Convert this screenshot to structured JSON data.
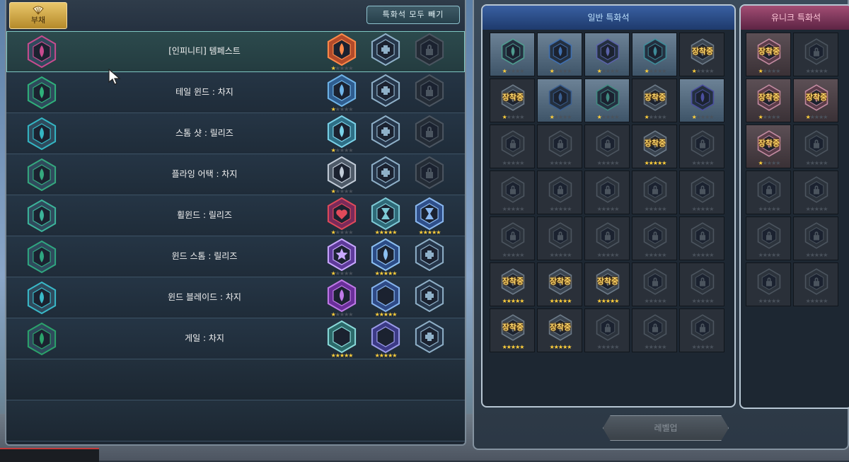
{
  "skill_panel": {
    "tab_label": "부채",
    "remove_all_label": "특화석 모두 빼기",
    "skills": [
      {
        "name": "[인피니티] 템페스트",
        "icon": "tempest-skill-icon",
        "icon_color": "#c84b8f",
        "slots": [
          {
            "state": "gem",
            "gem": "red-flame",
            "stars": 1
          },
          {
            "state": "add"
          },
          {
            "state": "locked"
          }
        ]
      },
      {
        "name": "테일 윈드 : 차지",
        "icon": "tailwind-skill-icon",
        "icon_color": "#2fb07a",
        "slots": [
          {
            "state": "gem",
            "gem": "blue-flame",
            "stars": 1
          },
          {
            "state": "add"
          },
          {
            "state": "locked"
          }
        ]
      },
      {
        "name": "스톰 샷 : 릴리즈",
        "icon": "storm-shot-skill-icon",
        "icon_color": "#34b6c4",
        "slots": [
          {
            "state": "gem",
            "gem": "cyan-flame",
            "stars": 1
          },
          {
            "state": "add"
          },
          {
            "state": "locked"
          }
        ]
      },
      {
        "name": "플라잉 어택 : 차지",
        "icon": "flying-attack-skill-icon",
        "icon_color": "#35a87e",
        "slots": [
          {
            "state": "gem",
            "gem": "silver-flame",
            "stars": 1
          },
          {
            "state": "add"
          },
          {
            "state": "locked"
          }
        ]
      },
      {
        "name": "휠윈드 : 릴리즈",
        "icon": "whirlwind-skill-icon",
        "icon_color": "#3cb49a",
        "slots": [
          {
            "state": "gem",
            "gem": "red-heart",
            "stars": 1
          },
          {
            "state": "gem",
            "gem": "hourglass-teal",
            "stars": 5
          },
          {
            "state": "gem",
            "gem": "hourglass-blue",
            "stars": 5
          }
        ]
      },
      {
        "name": "윈드 스톰 : 릴리즈",
        "icon": "windstorm-skill-icon",
        "icon_color": "#2fa680",
        "slots": [
          {
            "state": "gem",
            "gem": "purple-star",
            "stars": 1
          },
          {
            "state": "gem",
            "gem": "wing-blue",
            "stars": 5
          },
          {
            "state": "add"
          }
        ]
      },
      {
        "name": "윈드 블레이드 : 차지",
        "icon": "wind-blade-skill-icon",
        "icon_color": "#39b9c9",
        "slots": [
          {
            "state": "gem",
            "gem": "purple-drop",
            "stars": 1
          },
          {
            "state": "gem",
            "gem": "moon-blue",
            "stars": 5
          },
          {
            "state": "add"
          }
        ]
      },
      {
        "name": "게일 : 차지",
        "icon": "gale-skill-icon",
        "icon_color": "#2ba36b",
        "slots": [
          {
            "state": "gem",
            "gem": "moon-teal",
            "stars": 5
          },
          {
            "state": "gem",
            "gem": "moon-indigo",
            "stars": 5
          },
          {
            "state": "add"
          }
        ]
      }
    ]
  },
  "normal_stones": {
    "title": "일반 특화석",
    "equipped_text": "장착중",
    "cells": [
      {
        "state": "gem",
        "color": "#4f9c8f",
        "stars": 1
      },
      {
        "state": "gem",
        "color": "#3f6fb0",
        "stars": 1
      },
      {
        "state": "gem",
        "color": "#5a62a8",
        "stars": 1
      },
      {
        "state": "gem",
        "color": "#3e8c99",
        "stars": 1
      },
      {
        "state": "equipped",
        "stars": 1
      },
      {
        "state": "equipped",
        "stars": 1
      },
      {
        "state": "gem",
        "color": "#3a5e8f",
        "stars": 1
      },
      {
        "state": "gem",
        "color": "#3f8a80",
        "stars": 1
      },
      {
        "state": "equipped",
        "stars": 1
      },
      {
        "state": "gem",
        "color": "#4b4f9e",
        "stars": 1
      },
      {
        "state": "locked"
      },
      {
        "state": "locked"
      },
      {
        "state": "locked"
      },
      {
        "state": "equipped",
        "stars": 5
      },
      {
        "state": "locked"
      },
      {
        "state": "locked"
      },
      {
        "state": "locked"
      },
      {
        "state": "locked"
      },
      {
        "state": "locked"
      },
      {
        "state": "locked"
      },
      {
        "state": "locked"
      },
      {
        "state": "locked"
      },
      {
        "state": "locked"
      },
      {
        "state": "locked"
      },
      {
        "state": "locked"
      },
      {
        "state": "equipped",
        "stars": 5
      },
      {
        "state": "equipped",
        "stars": 5
      },
      {
        "state": "equipped",
        "stars": 5
      },
      {
        "state": "locked"
      },
      {
        "state": "locked"
      },
      {
        "state": "equipped",
        "stars": 5
      },
      {
        "state": "equipped",
        "stars": 5
      },
      {
        "state": "locked"
      },
      {
        "state": "locked"
      },
      {
        "state": "locked"
      }
    ]
  },
  "unique_stones": {
    "title": "유니크 특화석",
    "equipped_text": "장착중",
    "cells": [
      {
        "state": "equipped",
        "stars": 1
      },
      {
        "state": "locked"
      },
      {
        "state": "equipped",
        "stars": 1
      },
      {
        "state": "equipped",
        "stars": 1
      },
      {
        "state": "equipped",
        "stars": 1
      },
      {
        "state": "locked"
      },
      {
        "state": "locked"
      },
      {
        "state": "locked"
      },
      {
        "state": "locked"
      },
      {
        "state": "locked"
      },
      {
        "state": "locked"
      },
      {
        "state": "locked"
      }
    ]
  },
  "levelup_label": "레벨업",
  "colors": {
    "star_on": "#ffcf3b",
    "star_off": "#4a525c",
    "equipped_text": "#ffd76a",
    "selected_row_outline": "#7ec7c2"
  }
}
